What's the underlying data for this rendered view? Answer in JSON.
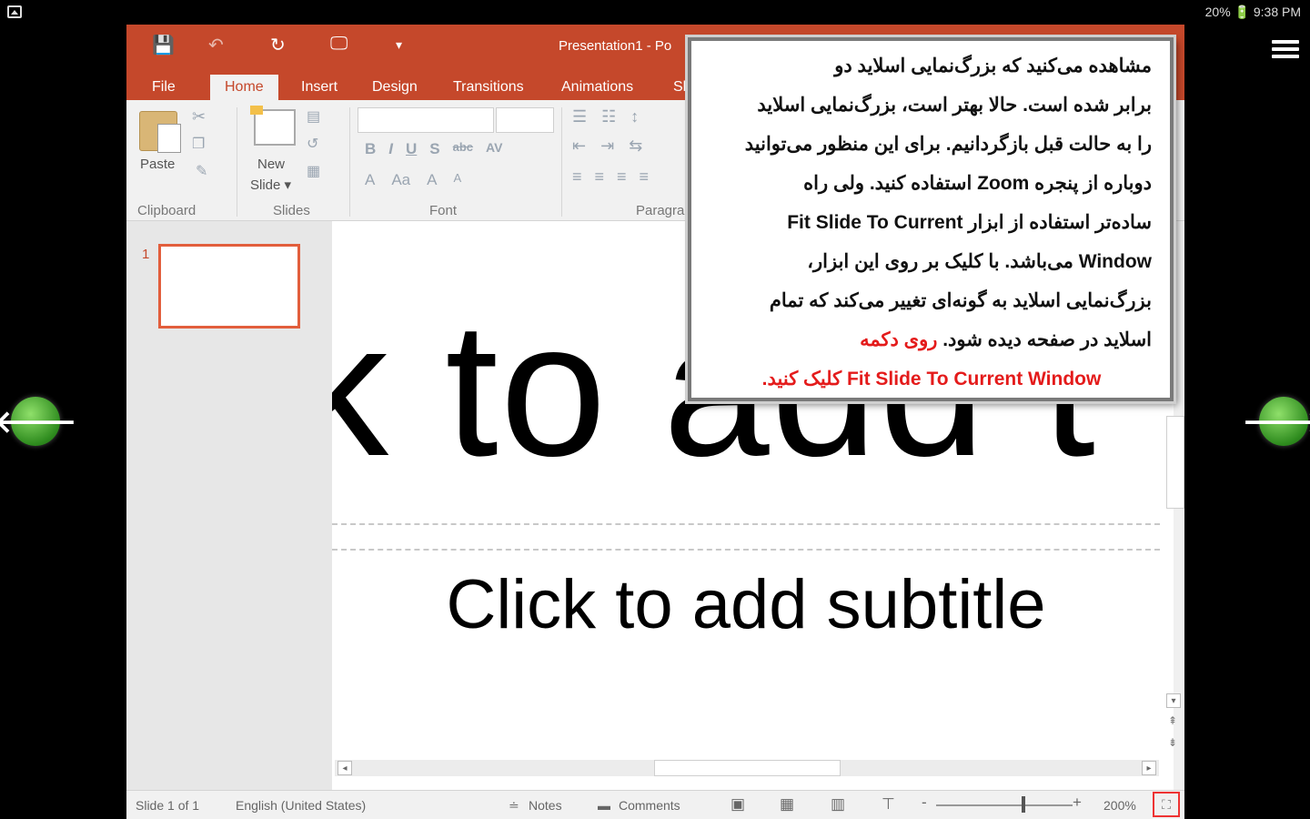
{
  "android": {
    "status": "20% 🔋 9:38 PM"
  },
  "nav": {
    "prev": "🡐",
    "next": "🡒"
  },
  "window": {
    "title": "Presentation1 - Po"
  },
  "qat": {
    "save": "💾",
    "undo": "↶",
    "redo": "↻",
    "present": "🖵",
    "more": "▾"
  },
  "tabs": [
    "File",
    "Home",
    "Insert",
    "Design",
    "Transitions",
    "Animations",
    "Sl"
  ],
  "ribbon": {
    "paste_label": "Paste",
    "new_slide_label1": "New",
    "new_slide_label2": "Slide ▾",
    "groups": {
      "clipboard": "Clipboard",
      "slides": "Slides",
      "font": "Font",
      "paragraph": "Paragra"
    },
    "font_buttons": [
      "B",
      "I",
      "U",
      "S",
      "abc",
      "AV"
    ],
    "font_buttons2": [
      "A",
      "Aa",
      "A",
      "A"
    ]
  },
  "slides_pane": {
    "number": "1"
  },
  "slide": {
    "title_placeholder": "ck to add t",
    "subtitle_placeholder": "Click to add subtitle"
  },
  "status": {
    "slide": "Slide 1 of 1",
    "language": "English (United States)",
    "notes": "Notes",
    "comments": "Comments",
    "zoom_minus": "-",
    "zoom_plus": "+",
    "zoom": "200%"
  },
  "note": {
    "lines": [
      "مشاهده می‌کنید که بزرگ‌نمایی اسلاید دو",
      "برابر شده است. حالا بهتر است، بزرگ‌نمایی اسلاید",
      "را به حالت قبل بازگردانیم. برای این منظور می‌توانید",
      "دوباره از پنجره Zoom استفاده کنید. ولی راه",
      "ساده‌تر استفاده از ابزار Fit Slide To Current",
      "Window می‌باشد. با کلیک بر روی این ابزار،",
      "بزرگ‌نمایی اسلاید به گونه‌ای تغییر می‌کند که تمام",
      "اسلاید در صفحه دیده شود."
    ],
    "line8_red": "روی دکمه",
    "line9_red": "Fit Slide To Current Window کلیک کنید."
  },
  "colors": {
    "accent": "#c5482b",
    "highlight": "#e41b1b"
  }
}
